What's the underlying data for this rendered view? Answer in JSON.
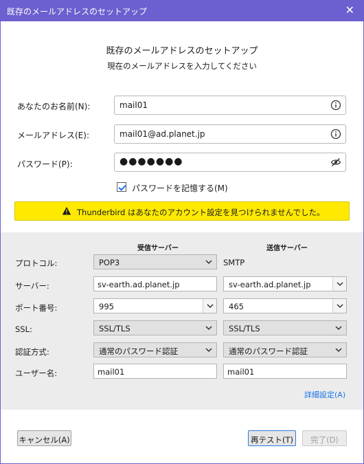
{
  "window": {
    "title": "既存のメールアドレスのセットアップ",
    "close_glyph": "✕"
  },
  "header": {
    "title": "既存のメールアドレスのセットアップ",
    "subtitle": "現在のメールアドレスを入力してください"
  },
  "form": {
    "name_label": "あなたのお名前(N):",
    "name_value": "mail01",
    "name_icon": "info-icon",
    "email_label": "メールアドレス(E):",
    "email_value": "mail01@ad.planet.jp",
    "email_icon": "info-icon",
    "password_label": "パスワード(P):",
    "password_value": "●●●●●●●",
    "password_icon": "eye-slash-icon",
    "remember_label": "パスワードを記憶する(M)",
    "remember_checked": true
  },
  "warning": {
    "text": "Thunderbird はあなたのアカウント設定を見つけられませんでした。",
    "icon": "warning-icon",
    "color": "#ffe900"
  },
  "settings": {
    "incoming_header": "受信サーバー",
    "outgoing_header": "送信サーバー",
    "protocol_label": "プロトコル:",
    "incoming_protocol": "POP3",
    "outgoing_protocol": "SMTP",
    "server_label": "サーバー:",
    "incoming_server": "sv-earth.ad.planet.jp",
    "outgoing_server": "sv-earth.ad.planet.jp",
    "port_label": "ポート番号:",
    "incoming_port": "995",
    "outgoing_port": "465",
    "ssl_label": "SSL:",
    "incoming_ssl": "SSL/TLS",
    "outgoing_ssl": "SSL/TLS",
    "auth_label": "認証方式:",
    "incoming_auth": "通常のパスワード認証",
    "outgoing_auth": "通常のパスワード認証",
    "username_label": "ユーザー名:",
    "incoming_username": "mail01",
    "outgoing_username": "mail01",
    "advanced_link": "詳細設定(A)"
  },
  "footer": {
    "cancel_label": "キャンセル(A)",
    "retest_label": "再テスト(T)",
    "done_label": "完了(D)"
  },
  "colors": {
    "titlebar": "#6c5fcf",
    "link": "#1a73e8",
    "settings_bg": "#ececec"
  }
}
